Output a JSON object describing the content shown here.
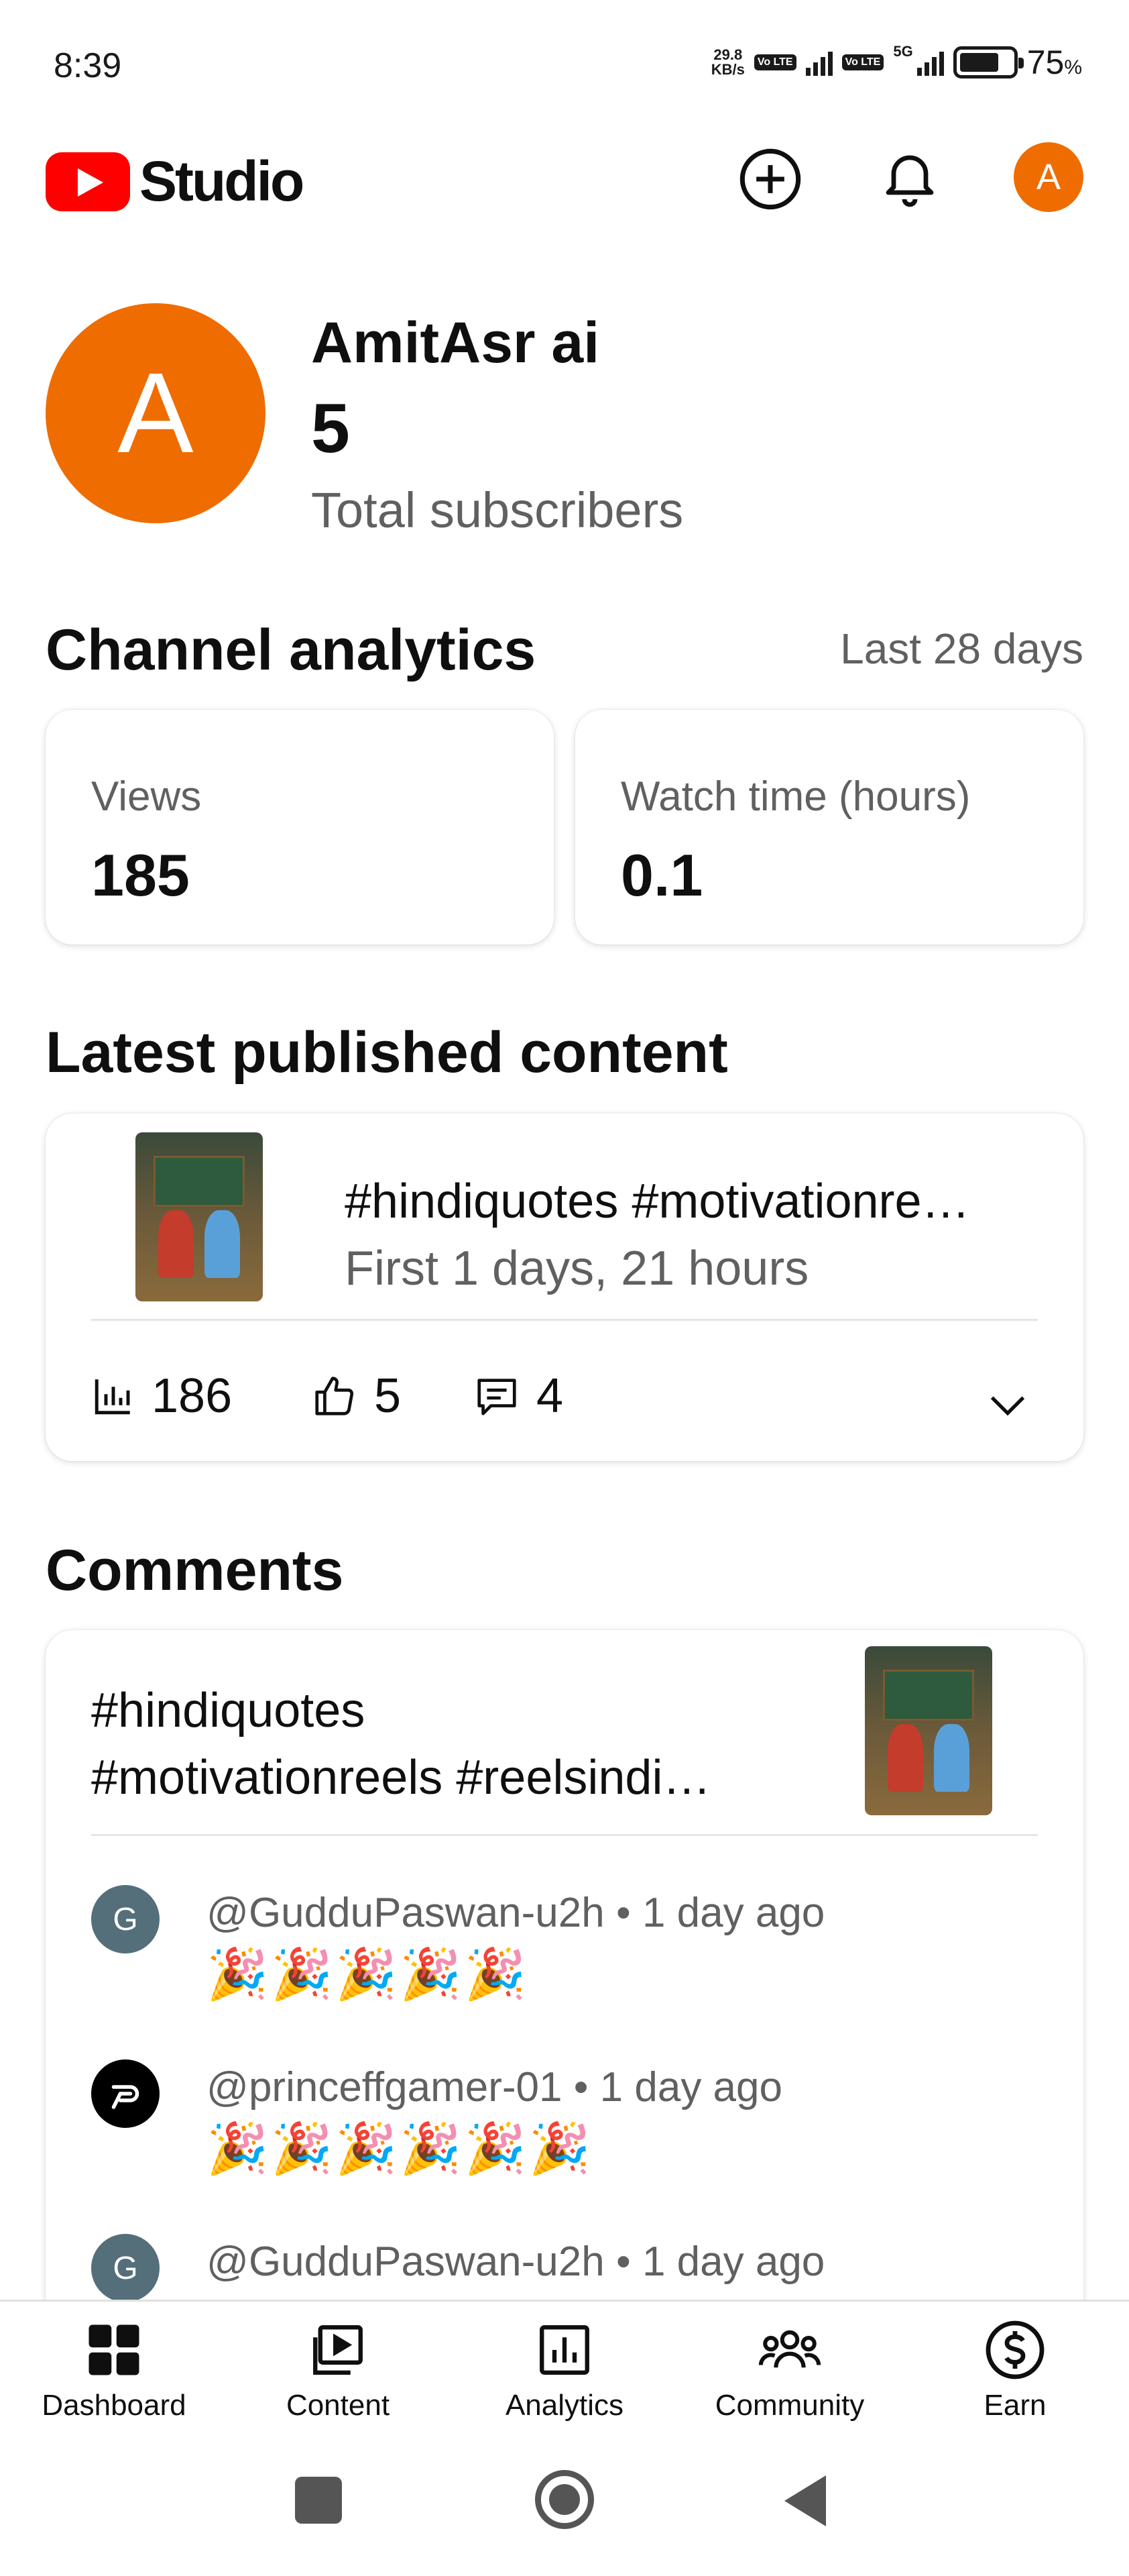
{
  "status_bar": {
    "time": "8:39",
    "net_speed_value": "29.8",
    "net_speed_unit": "KB/s",
    "volte_label": "Vo LTE",
    "network": "5G",
    "battery_percent": "75",
    "battery_unit": "%"
  },
  "header": {
    "app_name": "Studio",
    "account_initial": "A",
    "icons": [
      "create-plus-icon",
      "notifications-bell-icon"
    ]
  },
  "channel": {
    "initial": "A",
    "name": "AmitAsr ai",
    "subscriber_count": "5",
    "subscriber_label": "Total subscribers"
  },
  "analytics": {
    "title": "Channel analytics",
    "period": "Last 28 days",
    "metrics": [
      {
        "label": "Views",
        "value": "185"
      },
      {
        "label": "Watch time (hours)",
        "value": "0.1"
      }
    ]
  },
  "latest": {
    "title": "Latest published content",
    "video_title": "#hindiquotes #motivationre…",
    "subtitle": "First 1 days, 21 hours",
    "views": "186",
    "likes": "5",
    "comments": "4"
  },
  "comments": {
    "title": "Comments",
    "video_title_line1": "#hindiquotes",
    "video_title_line2": "#motivationreels #reelsindi…",
    "items": [
      {
        "initial": "G",
        "author": "@GudduPaswan-u2h",
        "time": "1 day ago",
        "text": "🎉🎉🎉🎉🎉",
        "avatar_color": "#546e7a"
      },
      {
        "initial": "",
        "author": "@princeffgamer-01",
        "time": "1 day ago",
        "text": "🎉🎉🎉🎉🎉🎉",
        "avatar_color": "#000000"
      },
      {
        "initial": "G",
        "author": "@GudduPaswan-u2h",
        "time": "1 day ago",
        "text": "",
        "avatar_color": "#546e7a"
      }
    ],
    "separator": " • "
  },
  "bottom_nav": [
    {
      "label": "Dashboard",
      "icon": "dashboard-icon"
    },
    {
      "label": "Content",
      "icon": "content-icon"
    },
    {
      "label": "Analytics",
      "icon": "analytics-icon"
    },
    {
      "label": "Community",
      "icon": "community-icon"
    },
    {
      "label": "Earn",
      "icon": "earn-icon"
    }
  ],
  "colors": {
    "brand_red": "#ff0000",
    "avatar_orange": "#ef6c00",
    "secondary_text": "#606060"
  }
}
